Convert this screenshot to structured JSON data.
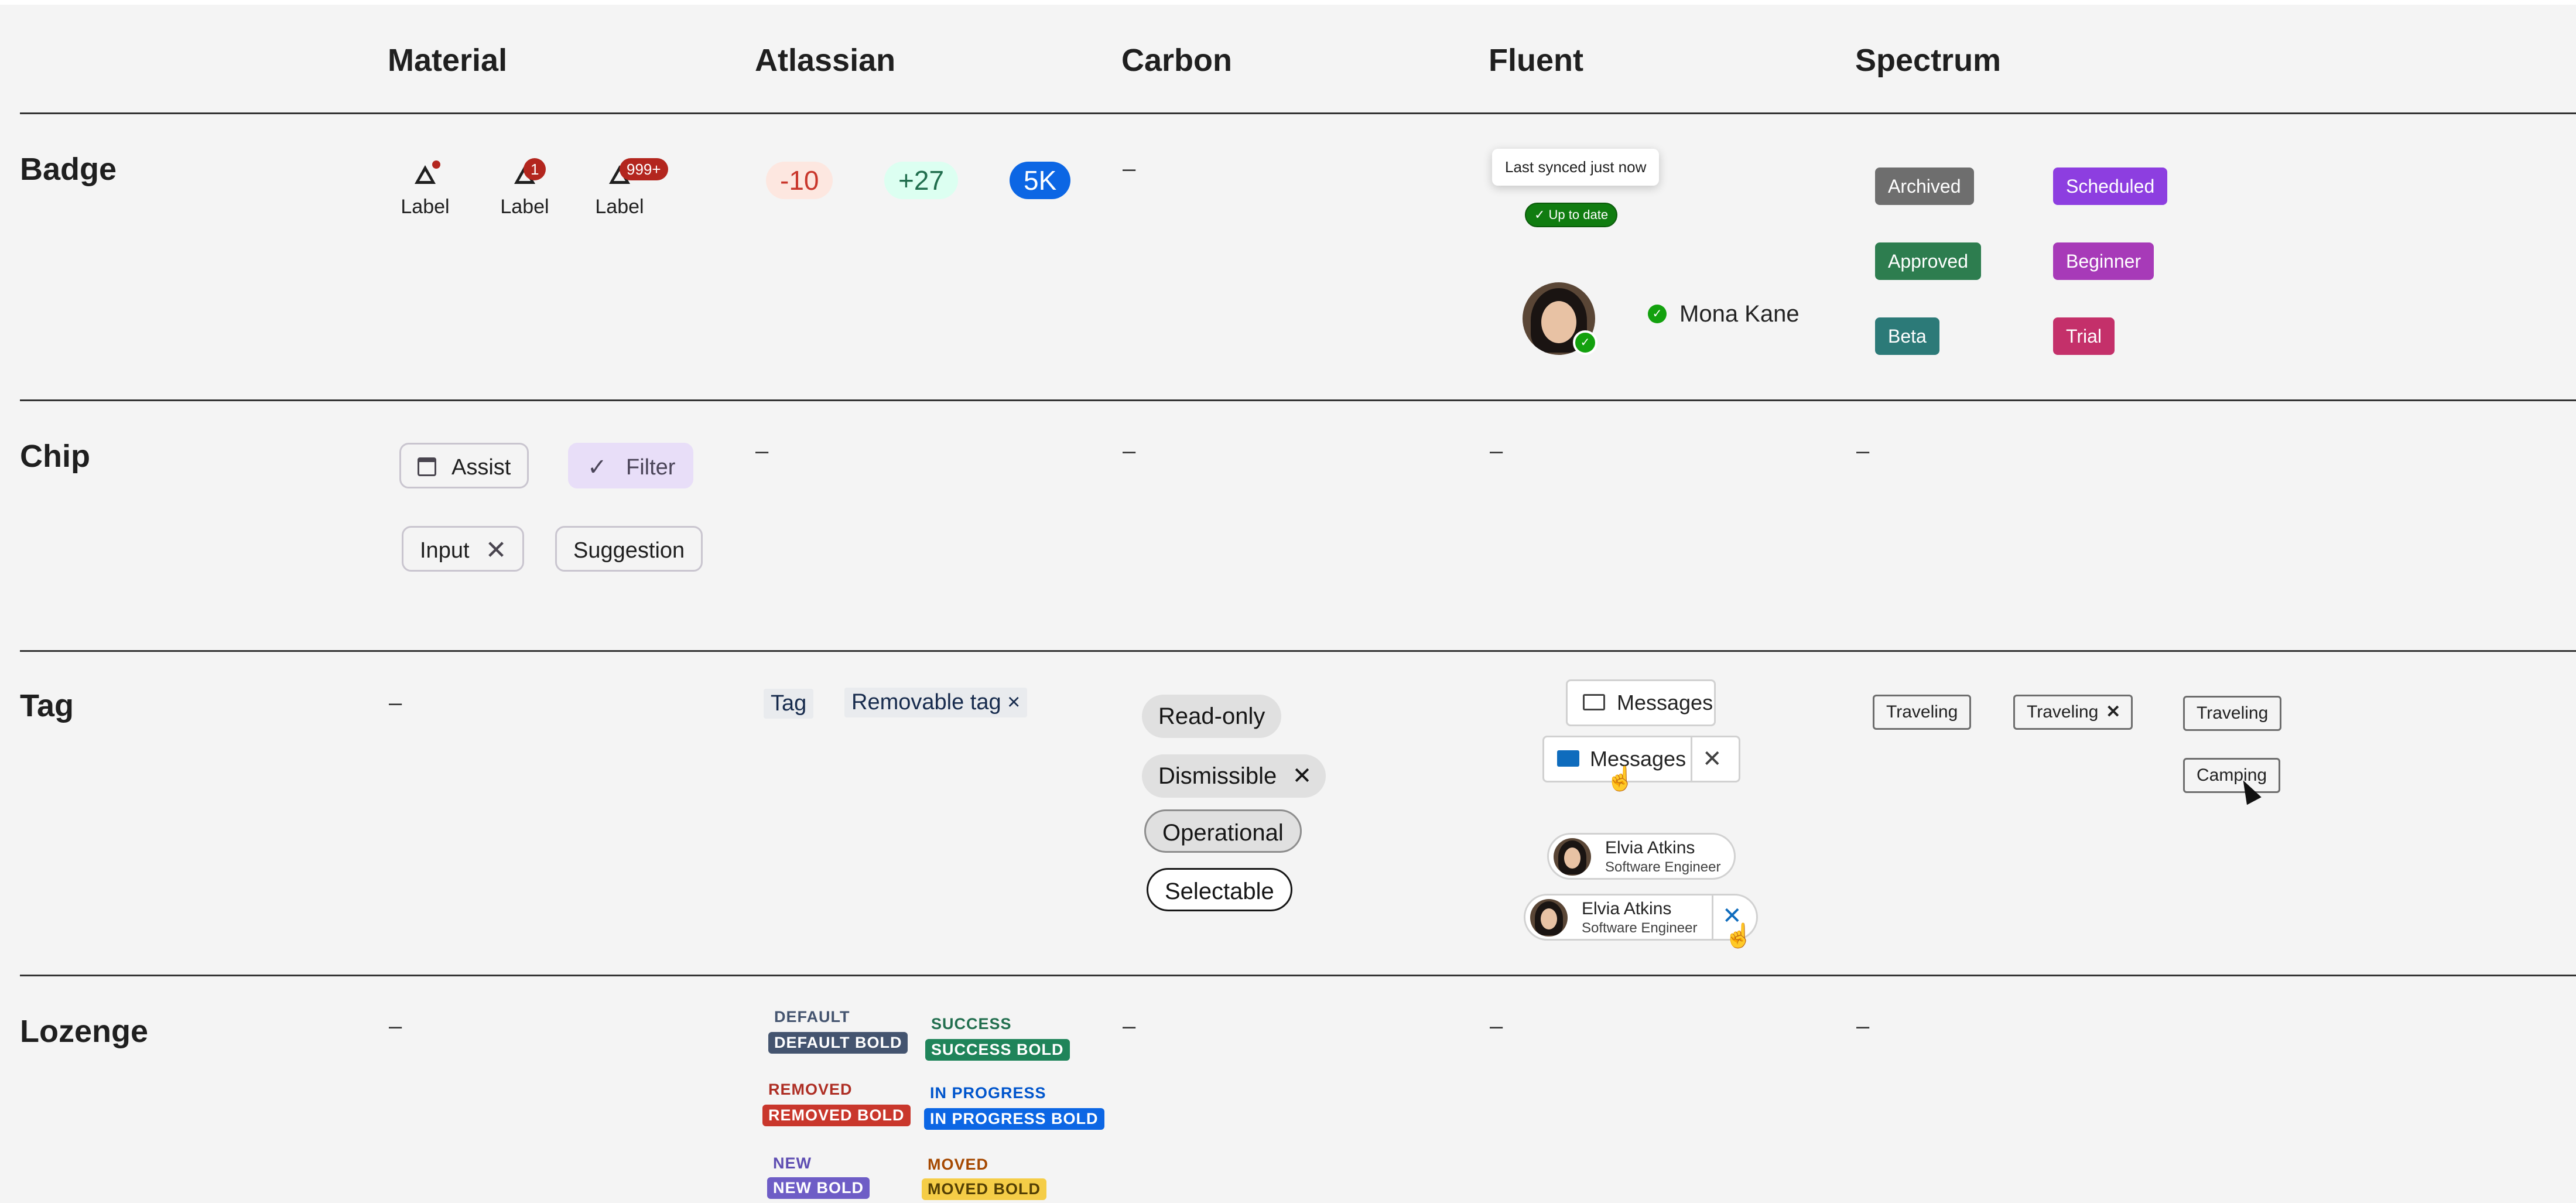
{
  "columns": [
    "Material",
    "Atlassian",
    "Carbon",
    "Fluent",
    "Spectrum"
  ],
  "rows": [
    "Badge",
    "Chip",
    "Tag",
    "Lozenge"
  ],
  "dash": "–",
  "material_badge": {
    "labels": [
      "Label",
      "Label",
      "Label"
    ],
    "counts": [
      "1",
      "999+"
    ]
  },
  "atlassian_badge": {
    "items": [
      "-10",
      "+27",
      "5K"
    ]
  },
  "fluent_badge": {
    "tooltip": "Last synced just now",
    "status": "✓ Up to date",
    "person_name": "Mona Kane",
    "presence_icon": "check-circle-icon"
  },
  "spectrum_badge": {
    "items": [
      "Archived",
      "Scheduled",
      "Approved",
      "Beginner",
      "Beta",
      "Trial"
    ]
  },
  "material_chip": {
    "assist": "Assist",
    "filter": "Filter",
    "input": "Input",
    "suggestion": "Suggestion"
  },
  "atlassian_tag": {
    "tag": "Tag",
    "removable": "Removable tag ×"
  },
  "carbon_tag": {
    "read_only": "Read-only",
    "dismissible": "Dismissible",
    "operational": "Operational",
    "selectable": "Selectable"
  },
  "fluent_tag": {
    "messages_1": "Messages",
    "messages_2": "Messages",
    "persona_1": {
      "name": "Elvia Atkins",
      "role": "Software Engineer"
    },
    "persona_2": {
      "name": "Elvia Atkins",
      "role": "Software Engineer"
    }
  },
  "spectrum_tag": {
    "t1": "Traveling",
    "t2": "Traveling",
    "t3": "Traveling",
    "t4": "Camping"
  },
  "atlassian_lozenge": {
    "default": "DEFAULT",
    "default_bold": "DEFAULT BOLD",
    "success": "SUCCESS",
    "success_bold": "SUCCESS BOLD",
    "removed": "REMOVED",
    "removed_bold": "REMOVED BOLD",
    "in_progress": "IN PROGRESS",
    "in_progress_bold": "IN PROGRESS BOLD",
    "new": "NEW",
    "new_bold": "NEW BOLD",
    "moved": "MOVED",
    "moved_bold": "MOVED BOLD"
  },
  "colors": {
    "carbon_tag_bg": "#e0e0e0",
    "fluent_green": "#107c10",
    "material_error": "#b3261e",
    "archived": "#6e6e6e",
    "scheduled": "#8d3ee0",
    "approved": "#2d7d4f",
    "beginner": "#a73ab8",
    "beta": "#2c7a78",
    "trial": "#c4306a"
  }
}
